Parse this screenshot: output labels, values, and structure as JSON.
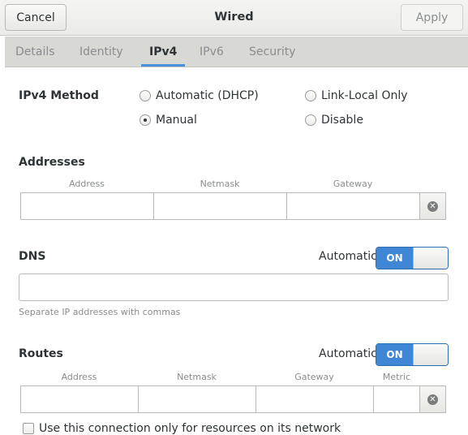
{
  "header": {
    "cancel_label": "Cancel",
    "title": "Wired",
    "apply_label": "Apply"
  },
  "tabs": [
    {
      "label": "Details"
    },
    {
      "label": "Identity"
    },
    {
      "label": "IPv4"
    },
    {
      "label": "IPv6"
    },
    {
      "label": "Security"
    }
  ],
  "active_tab": "IPv4",
  "ipv4_method": {
    "label": "IPv4 Method",
    "options": [
      {
        "label": "Automatic (DHCP)",
        "selected": false
      },
      {
        "label": "Link-Local Only",
        "selected": false
      },
      {
        "label": "Manual",
        "selected": true
      },
      {
        "label": "Disable",
        "selected": false
      }
    ]
  },
  "addresses": {
    "label": "Addresses",
    "columns": [
      "Address",
      "Netmask",
      "Gateway"
    ],
    "row": [
      "",
      "",
      ""
    ]
  },
  "dns": {
    "label": "DNS",
    "automatic_label": "Automatic",
    "switch_label": "ON",
    "value": "",
    "hint": "Separate IP addresses with commas"
  },
  "routes": {
    "label": "Routes",
    "automatic_label": "Automatic",
    "switch_label": "ON",
    "columns": [
      "Address",
      "Netmask",
      "Gateway",
      "Metric"
    ],
    "row": [
      "",
      "",
      "",
      ""
    ]
  },
  "only_local_label": "Use this connection only for resources on its network",
  "colors": {
    "accent": "#3f87d5",
    "tab_underline": "#4a90d9",
    "header_bg": "#efefed"
  }
}
